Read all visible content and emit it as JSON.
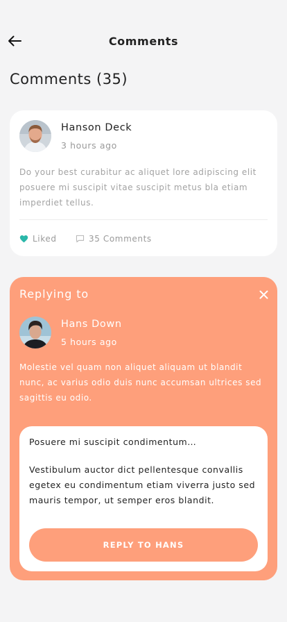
{
  "header": {
    "title": "Comments",
    "back_icon": "arrow-left-icon"
  },
  "section": {
    "title": "Comments (35)"
  },
  "comment": {
    "author": "Hanson Deck",
    "time_ago": "3 hours ago",
    "body": "Do your best curabitur ac aliquet lore adipiscing elit posuere mi suscipit vitae suscipit metus bla etiam imperdiet tellus.",
    "liked_label": "Liked",
    "comments_label": "35 Comments",
    "heart_color": "#2ab7a9"
  },
  "reply_card": {
    "heading": "Replying to",
    "close_icon": "close-icon",
    "background": "#fe9f7b",
    "author": "Hans Down",
    "time_ago": "5 hours ago",
    "body": "Molestie vel quam non aliquet aliquam ut blandit nunc, ac varius odio duis  nunc accumsan ultrices sed sagittis eu odio.",
    "reply_text_line1": "Posuere mi suscipit condimentum…",
    "reply_text_line2": "Vestibulum auctor dict pellentesque convallis egetex eu condimentum etiam viverra justo sed mauris tempor, ut semper eros blandit.",
    "button_label": "REPLY TO HANS"
  }
}
